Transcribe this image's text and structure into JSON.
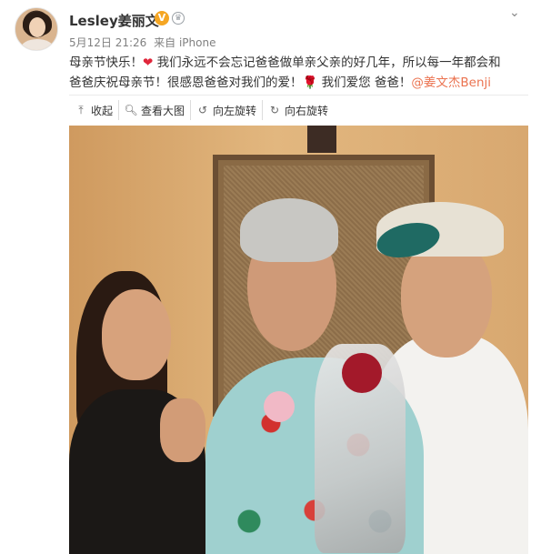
{
  "user": {
    "name": "Lesley姜丽文",
    "verified_badge": "V",
    "crown_icon": "crown-icon"
  },
  "meta": {
    "date": "5月12日 21:26",
    "source": "来自 iPhone"
  },
  "post": {
    "line1_a": "母亲节快乐！",
    "line1_b": "我们永远不会忘记爸爸做单亲父亲的好几年，所以每一年都会和",
    "line2_a": "爸爸庆祝母亲节！很感恩爸爸对我们的爱！",
    "line2_b": "我们爱您 爸爸！",
    "mention": "@姜文杰Benji",
    "heart_emoji": "❤",
    "rose_emoji": "🌹"
  },
  "toolbar": {
    "collapse": "收起",
    "view_large": "查看大图",
    "rotate_left": "向左旋转",
    "rotate_right": "向右旋转"
  },
  "colors": {
    "mention": "#eb7350",
    "badge": "#f5a623"
  }
}
